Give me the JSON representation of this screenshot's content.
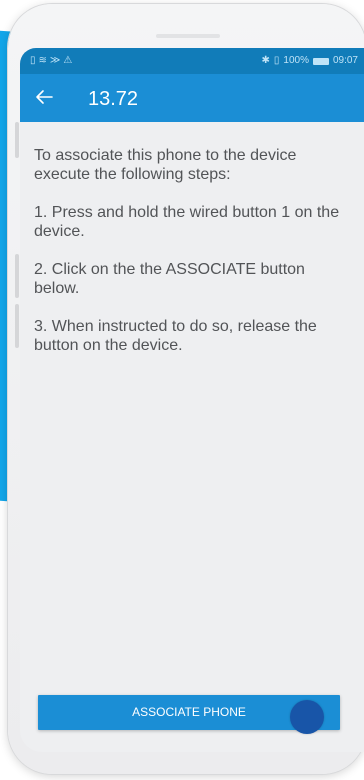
{
  "status_bar": {
    "left_icons": [
      "sim-icon",
      "wifi-icon",
      "cast-icon",
      "warning-icon"
    ],
    "battery_percent": "100%",
    "time": "09:07"
  },
  "app_bar": {
    "title": "13.72",
    "back_icon": "arrow-left-icon"
  },
  "instructions": {
    "intro": "To associate this phone to the device execute the following steps:",
    "step1": "1. Press and hold the wired button 1 on the device.",
    "step2": "2. Click on the the ASSOCIATE button below.",
    "step3": "3. When instructed to do so, release the button on the device."
  },
  "associate_button": {
    "label": "ASSOCIATE PHONE"
  },
  "colors": {
    "status_bar": "#117cb9",
    "app_bar": "#1b8ed5",
    "screen_bg": "#eeeff1",
    "text": "#525457",
    "touch_indicator": "#1855a8",
    "backdrop": "#12a6ea"
  }
}
